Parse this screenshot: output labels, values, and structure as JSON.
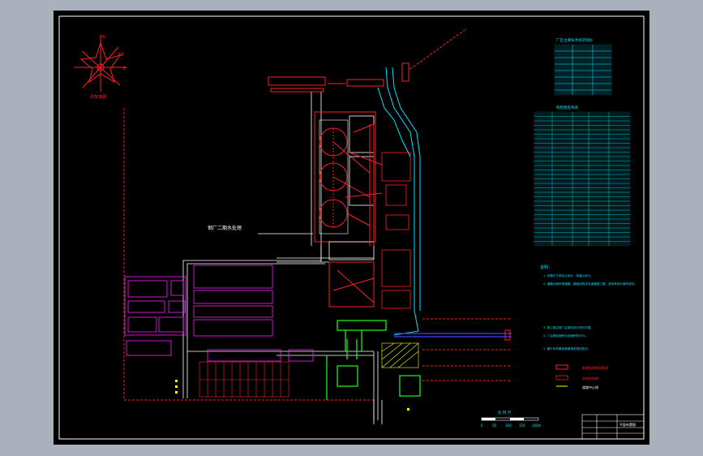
{
  "drawing": {
    "site_label": "钢厂二期水处理",
    "compass_label": "风玫瑰图",
    "coord_a": "N",
    "coord_b": "NE",
    "coord_c": "E"
  },
  "tables": {
    "summary_title": "厂区主要技术经济指标",
    "list_title": "构筑物名称表",
    "list_rows": 30
  },
  "notes": {
    "heading": "说明：",
    "lines": [
      "1. 本图尺寸单位以米计，标高以米计。",
      "2. 道路为城市型道路，路面结构详见道路施工图，坐标系统为城市坐标。",
      "3. 施工前应按厂区竖向设计进行平整。",
      "4. 厂区绿化面积为总面积的30%。",
      "5. 图中未尽事宜参照相关规范执行。"
    ],
    "legend": [
      {
        "label": "新建构筑物及管线",
        "color": "#ff2020"
      },
      {
        "label": "原有构筑物",
        "color": "#ff2020"
      },
      {
        "label": "道路中心线",
        "color": "#ffff00"
      }
    ]
  },
  "scale": {
    "title": "比 例 尺",
    "ticks": [
      "0",
      "50",
      "100",
      "150",
      "200m"
    ]
  },
  "title_block": {
    "project": "平面布置图"
  },
  "colors": {
    "background": "#000000",
    "screen": "#a9b1bd",
    "frame": "#ffffff",
    "red": "#ff2020",
    "cyan": "#00e5ff",
    "magenta": "#ff20ff",
    "green": "#20ff20",
    "yellow": "#ffff00",
    "blue": "#4040ff"
  }
}
